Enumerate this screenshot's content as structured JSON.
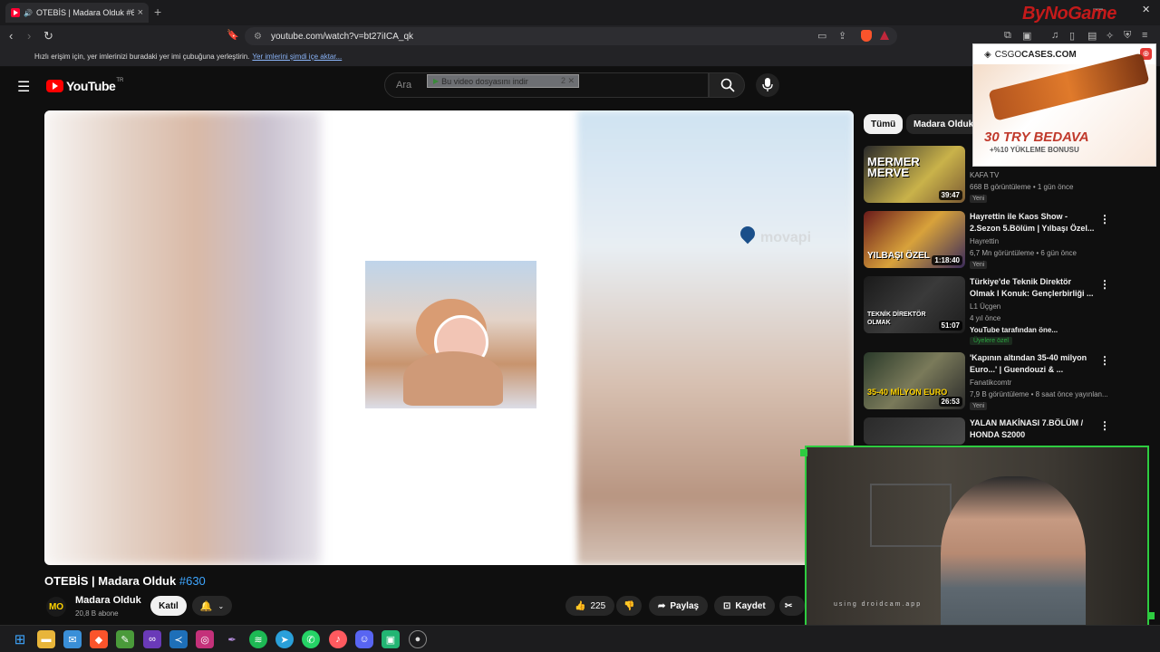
{
  "browser": {
    "tab_title": "OTEBİS | Madara Olduk #630",
    "url": "youtube.com/watch?v=bt27iICA_qk",
    "bookmarks_text": "Hızlı erişim için, yer imlerinizi buradaki yer imi çubuğuna yerleştirin.",
    "bookmarks_link": "Yer imlerini şimdi içe aktar..."
  },
  "overlay": {
    "brand": "ByNoGame",
    "download_bar": "Bu video dosyasını indir",
    "download_extra": "2 ✕",
    "ad_site_pre": "CSGO",
    "ad_site": "CASES.COM",
    "ad_headline": "30 TRY BEDAVA",
    "ad_sub": "+%10 YÜKLEME BONUSU",
    "webcam_caption": "using droidcam.app"
  },
  "youtube": {
    "logo": "YouTube",
    "region": "TR",
    "search_placeholder": "Ara",
    "video": {
      "title": "OTEBİS | Madara Olduk",
      "tag": "#630",
      "channel": "Madara Olduk",
      "subs": "20,8 B abone",
      "channel_initials": "MO",
      "join": "Katıl",
      "likes": "225",
      "share": "Paylaş",
      "save": "Kaydet",
      "watermark": "movapi"
    },
    "chips": [
      "Tümü",
      "Madara Olduk"
    ],
    "related": [
      {
        "title": "",
        "channel": "KAFA TV",
        "meta": "668 B görüntüleme • 1 gün önce",
        "badge": "Yeni",
        "duration": "39:47",
        "thumb_text": "MERMER MERVE"
      },
      {
        "title": "Hayrettin ile Kaos Show - 2.Sezon 5.Bölüm | Yılbaşı Özel...",
        "channel": "Hayrettin",
        "meta": "6,7 Mn görüntüleme • 6 gün önce",
        "badge": "Yeni",
        "duration": "1:18:40",
        "thumb_text": "YILBAŞI ÖZEL"
      },
      {
        "title": "Türkiye'de Teknik Direktör Olmak I Konuk: Gençlerbirliği ...",
        "channel": "L1 Üçgen",
        "meta": "4 yıl önce",
        "extra": "YouTube tarafından öne...",
        "member": "Üyelere özel",
        "duration": "51:07",
        "thumb_text": "TEKNİK DİREKTÖR OLMAK"
      },
      {
        "title": "'Kapının altından 35-40 milyon Euro...' | Guendouzi & ...",
        "channel": "Fanatikcomtr",
        "meta": "7,9 B görüntüleme • 8 saat önce yayınlan...",
        "badge": "Yeni",
        "duration": "26:53",
        "thumb_text": "35-40 MİLYON EURO"
      },
      {
        "title": "YALAN MAKİNASI 7.BÖLÜM / HONDA S2000",
        "channel": "",
        "meta": "",
        "duration": "",
        "thumb_text": ""
      }
    ]
  },
  "colors": {
    "accent_red": "#ff0000",
    "link_blue": "#3ea6ff",
    "webcam_border": "#2ecc40"
  }
}
